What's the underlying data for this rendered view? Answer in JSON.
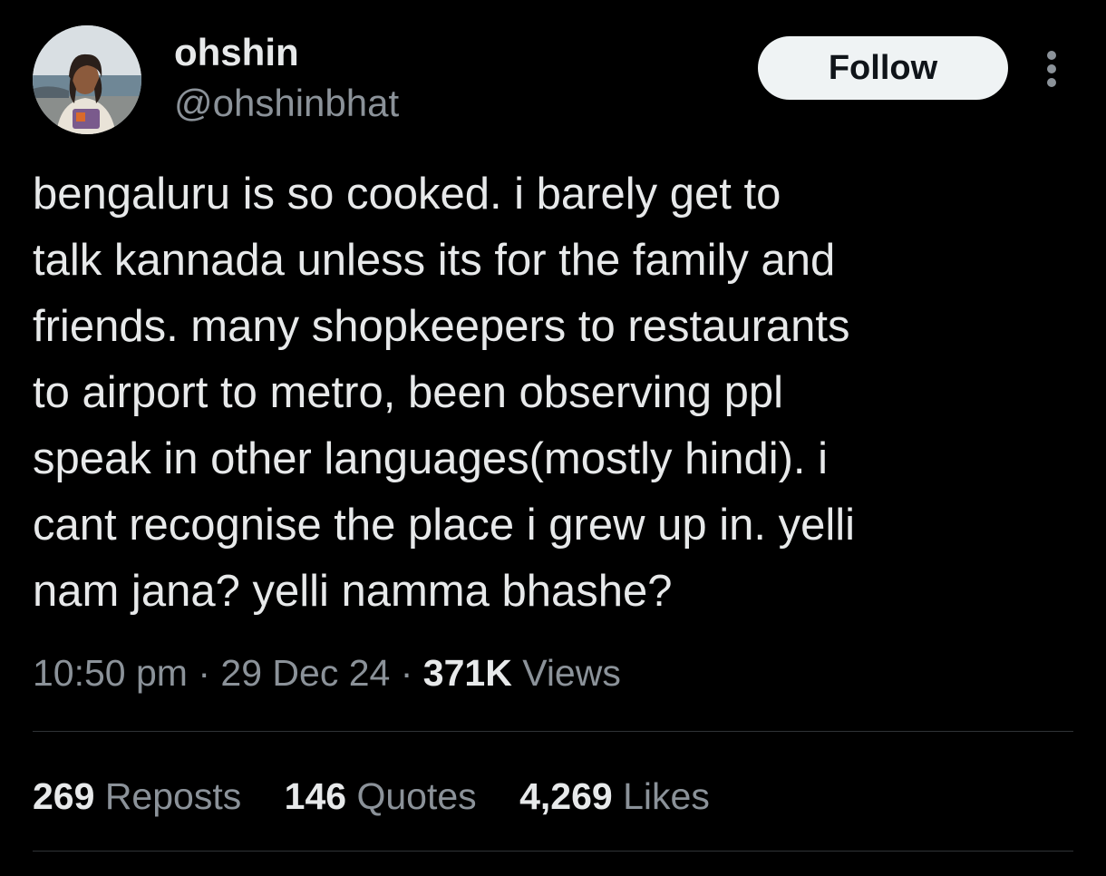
{
  "author": {
    "display_name": "ohshin",
    "handle": "@ohshinbhat",
    "avatar_icon": "profile-photo"
  },
  "actions": {
    "follow_label": "Follow",
    "more_icon": "more-vertical-icon"
  },
  "tweet": {
    "lines": [
      "bengaluru is so cooked. i barely get to",
      "talk kannada unless its for the family and",
      "friends. many shopkeepers to restaurants",
      "to airport to metro, been observing ppl",
      "speak in other languages(mostly hindi). i",
      "cant recognise the place i grew up in. yelli",
      "nam jana? yelli namma bhashe?"
    ]
  },
  "meta": {
    "time": "10:50 pm",
    "separator": "·",
    "date": "29 Dec 24",
    "views_count": "371K",
    "views_label": "Views"
  },
  "stats": {
    "reposts_count": "269",
    "reposts_label": "Reposts",
    "quotes_count": "146",
    "quotes_label": "Quotes",
    "likes_count": "4,269",
    "likes_label": "Likes"
  },
  "colors": {
    "background": "#000000",
    "primary_text": "#e7e9ea",
    "secondary_text": "#8b9299",
    "divider": "#2f3336",
    "button_bg": "#eff3f4"
  }
}
